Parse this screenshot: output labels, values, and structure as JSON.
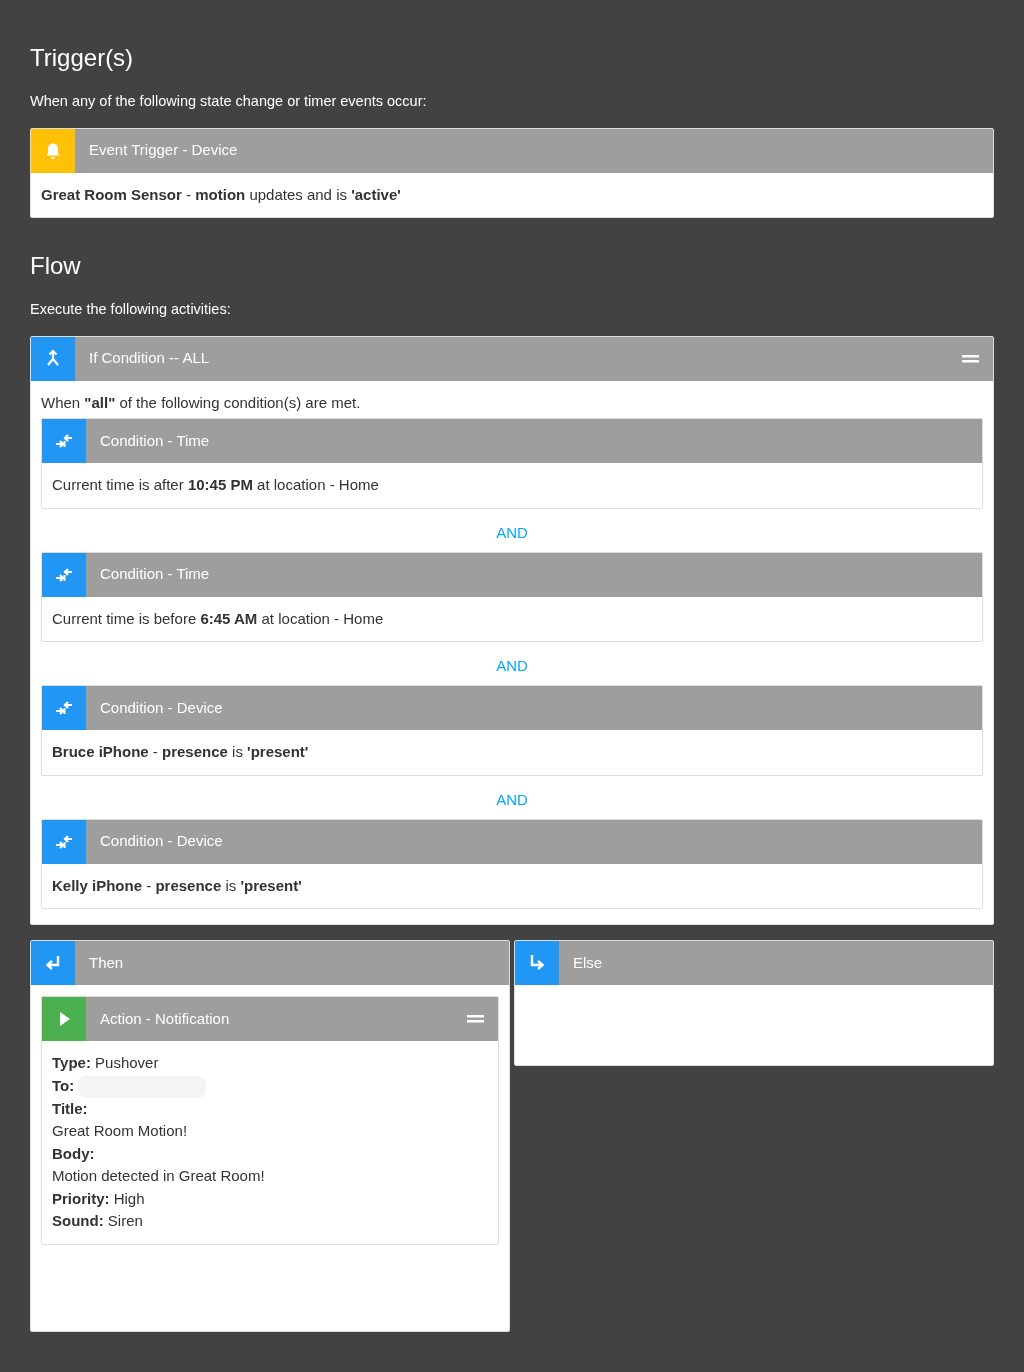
{
  "trigger_section": {
    "heading": "Trigger(s)",
    "subtitle": "When any of the following state change or timer events occur:",
    "blocks": [
      {
        "kind": "trigger",
        "color": "#ffc107",
        "title": "Event Trigger - Device",
        "collapse_handle": false,
        "lines": [
          {
            "text": "**Great Room Sensor** - **motion** updates and is **'active'**"
          }
        ]
      }
    ]
  },
  "flow_section": {
    "heading": "Flow",
    "subtitle": "Execute the following activities:",
    "if_block": {
      "kind": "if",
      "color": "#2196f3",
      "title": "If Condition -- ALL",
      "collapse_handle": true,
      "intro": "When **\"all\"** of the following condition(s) are met.",
      "conditions": [
        {
          "kind": "condition",
          "color": "#2196f3",
          "title": "Condition - Time",
          "collapse_handle": false,
          "lines": [
            {
              "text": "Current time is after **10:45 PM** at location - Home"
            }
          ]
        },
        {
          "kind": "condition",
          "color": "#2196f3",
          "title": "Condition - Time",
          "collapse_handle": false,
          "lines": [
            {
              "text": "Current time is before **6:45 AM** at location - Home"
            }
          ]
        },
        {
          "kind": "condition",
          "color": "#2196f3",
          "title": "Condition - Device",
          "collapse_handle": false,
          "lines": [
            {
              "text": "**Bruce iPhone** - **presence** is **'present'**"
            }
          ]
        },
        {
          "kind": "condition",
          "color": "#2196f3",
          "title": "Condition - Device",
          "collapse_handle": false,
          "lines": [
            {
              "text": "**Kelly iPhone** - **presence** is **'present'**"
            }
          ]
        }
      ],
      "joiners": [
        "AND",
        "AND",
        "AND"
      ]
    },
    "branches": [
      {
        "kind": "then",
        "color": "#2196f3",
        "title": "Then",
        "actions": [
          {
            "kind": "action",
            "color": "#4caf50",
            "title": "Action - Notification",
            "collapse_handle": true,
            "lines": [
              {
                "text": "**Type:** Pushover"
              },
              {
                "text": "**To:**",
                "redacted": true
              },
              {
                "text": "**Title:**"
              },
              {
                "text": "Great Room Motion!"
              },
              {
                "text": "**Body:**"
              },
              {
                "text": "Motion detected in Great Room!"
              },
              {
                "text": "**Priority:** High"
              },
              {
                "text": "**Sound:** Siren"
              }
            ]
          }
        ]
      },
      {
        "kind": "else",
        "color": "#2196f3",
        "title": "Else"
      }
    ]
  }
}
